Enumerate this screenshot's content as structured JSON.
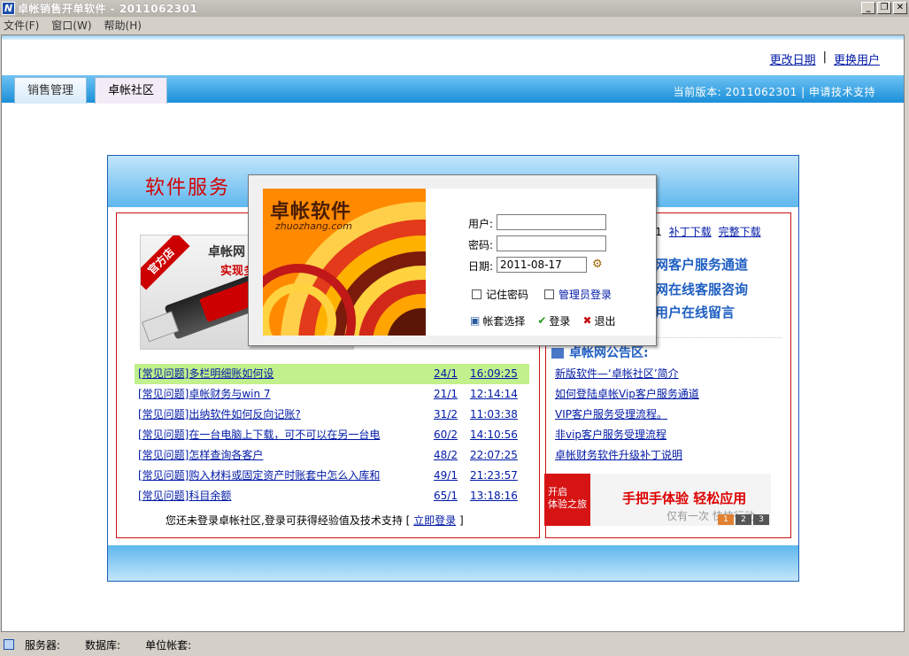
{
  "window": {
    "title": "卓帐销售开单软件 -  2011062301",
    "buttons": [
      "_",
      "❐",
      "✕"
    ]
  },
  "menu": [
    "文件(F)",
    "窗口(W)",
    "帮助(H)"
  ],
  "toplinks": {
    "change_date": "更改日期",
    "separator": "|",
    "change_user": "更换用户"
  },
  "tabs": [
    {
      "label": "销售管理"
    },
    {
      "label": "卓帐社区"
    }
  ],
  "version_bar": "当前版本: 2011062301 | 申请技术支持",
  "panel": {
    "title": "软件服务"
  },
  "promo": {
    "ribbon": "官方店",
    "title": "卓帐网",
    "subtitle": "实现多"
  },
  "faq": [
    {
      "q": "[常见问题]多栏明细账如何设",
      "n": "24/1",
      "t": "16:09:25"
    },
    {
      "q": "[常见问题]卓帐财务与win 7",
      "n": "21/1",
      "t": "12:14:14"
    },
    {
      "q": "[常见问题]出纳软件如何反向记账?",
      "n": "31/2",
      "t": "11:03:38"
    },
    {
      "q": "[常见问题]在一台电脑上下载，可不可以在另一台电",
      "n": "60/2",
      "t": "14:10:56"
    },
    {
      "q": "[常见问题]怎样查询各客户",
      "n": "48/2",
      "t": "22:07:25"
    },
    {
      "q": "[常见问题]购入材料或固定资产时账套中怎么入库和",
      "n": "49/1",
      "t": "21:23:57"
    },
    {
      "q": "[常见问题]科目余额",
      "n": "65/1",
      "t": "13:18:16"
    }
  ],
  "login_msg": {
    "text": "您还未登录卓帐社区,登录可获得经验值及技术支持 [",
    "link": "立即登录",
    "close": "]"
  },
  "right": {
    "download_prefix": "301",
    "patch": "补丁下载",
    "full": "完整下载",
    "services": [
      "帐网客户服务通道",
      "帐网在线客服咨询",
      "帐用户在线留言"
    ],
    "section": "卓帐网公告区:",
    "news": [
      "新版软件—‘卓帐社区’简介",
      "如何登陆卓帐Vip客户服务通道",
      "VIP客户服务受理流程。",
      "非vip客户服务受理流程",
      "卓帐财务软件升级补丁说明"
    ],
    "banner": {
      "left": "开启\n体验之旅",
      "main": "手把手体验 轻松应用",
      "sub": "仅有一次 快快行动",
      "pages": [
        "1",
        "2",
        "3"
      ]
    }
  },
  "login": {
    "logo": "卓帐软件",
    "logo_url": "zhuozhang.com",
    "user_label": "用户:",
    "user_value": "",
    "pass_label": "密码:",
    "pass_value": "",
    "date_label": "日期:",
    "date_value": "2011-08-17",
    "remember": "记住密码",
    "admin": "管理员登录",
    "btn_account": "帐套选择",
    "btn_login": "登录",
    "btn_exit": "退出"
  },
  "status": {
    "server": "服务器:",
    "database": "数据库:",
    "unit": "单位帐套:"
  }
}
